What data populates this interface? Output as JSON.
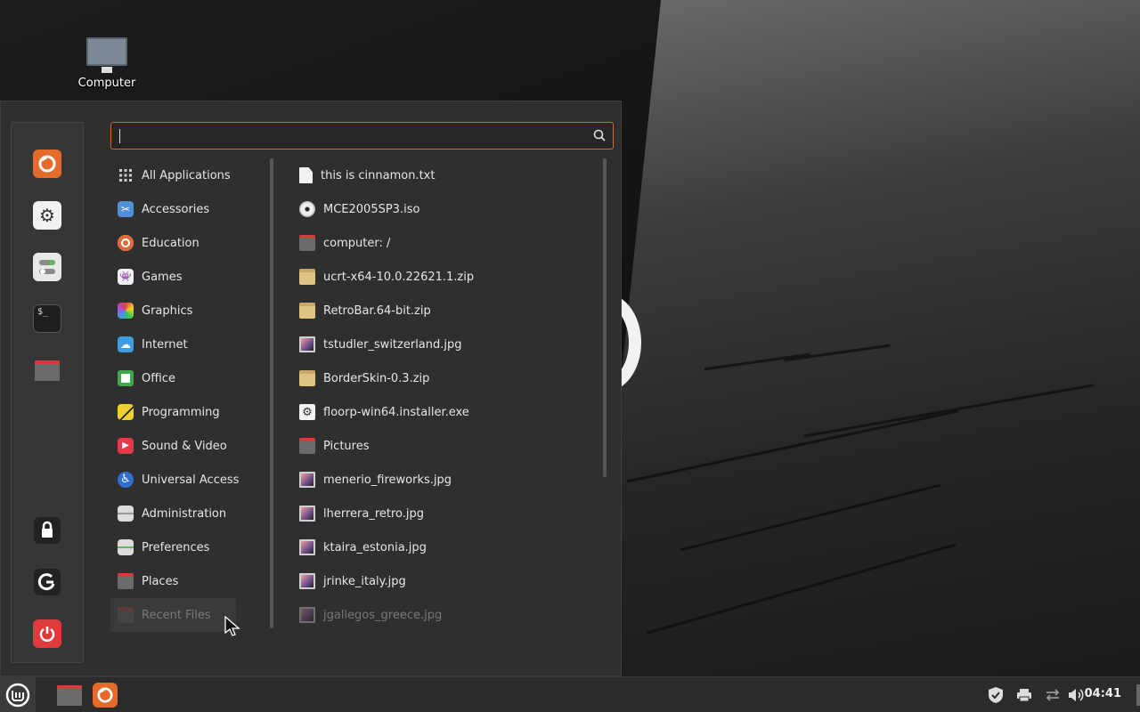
{
  "desktop": {
    "icons": [
      {
        "label": "Computer",
        "icon": "computer-icon"
      }
    ]
  },
  "menu": {
    "search": {
      "value": "",
      "placeholder": ""
    },
    "sidebar": {
      "top": [
        {
          "name": "firefox",
          "icon": "firefox-icon",
          "color": "#e66a2c"
        },
        {
          "name": "system-settings",
          "icon": "gear-icon",
          "color": "#f2f2f2"
        },
        {
          "name": "configuration",
          "icon": "toggles-icon",
          "color": "#e8e8e8"
        },
        {
          "name": "terminal",
          "icon": "terminal-icon",
          "color": "#1e1e1e"
        },
        {
          "name": "files",
          "icon": "folder-icon",
          "color": "#d23c3c"
        }
      ],
      "bottom": [
        {
          "name": "lock-screen",
          "icon": "lock-icon"
        },
        {
          "name": "logout",
          "icon": "logout-icon"
        },
        {
          "name": "shutdown",
          "icon": "power-icon",
          "color": "#e03b3b"
        }
      ]
    },
    "categories": [
      {
        "label": "All Applications",
        "icon": "grid-icon"
      },
      {
        "label": "Accessories",
        "icon": "scissors-icon",
        "color": "#4e8fd8"
      },
      {
        "label": "Education",
        "icon": "education-icon",
        "color": "#e06a3a"
      },
      {
        "label": "Games",
        "icon": "gamepad-icon",
        "color": "#f0f0f0"
      },
      {
        "label": "Graphics",
        "icon": "palette-icon",
        "color": "#d04cc8"
      },
      {
        "label": "Internet",
        "icon": "cloud-icon",
        "color": "#3d9ce0"
      },
      {
        "label": "Office",
        "icon": "office-icon",
        "color": "#3ea84a"
      },
      {
        "label": "Programming",
        "icon": "programming-icon",
        "color": "#f0d030"
      },
      {
        "label": "Sound & Video",
        "icon": "play-icon",
        "color": "#e03b4b"
      },
      {
        "label": "Universal Access",
        "icon": "accessibility-icon",
        "color": "#2f6fd0"
      },
      {
        "label": "Administration",
        "icon": "admin-icon",
        "color": "#dcdcdc"
      },
      {
        "label": "Preferences",
        "icon": "preferences-icon",
        "color": "#dcdcdc"
      },
      {
        "label": "Places",
        "icon": "folder-icon",
        "color": "#d23c3c"
      },
      {
        "label": "Recent Files",
        "icon": "recent-icon",
        "color": "#d23c3c"
      }
    ],
    "files": [
      {
        "label": "this is cinnamon.txt",
        "icon": "text-file-icon"
      },
      {
        "label": "MCE2005SP3.iso",
        "icon": "disc-icon"
      },
      {
        "label": "computer: /",
        "icon": "folder-icon"
      },
      {
        "label": "ucrt-x64-10.0.22621.1.zip",
        "icon": "archive-icon"
      },
      {
        "label": "RetroBar.64-bit.zip",
        "icon": "archive-icon"
      },
      {
        "label": "tstudler_switzerland.jpg",
        "icon": "image-icon"
      },
      {
        "label": "BorderSkin-0.3.zip",
        "icon": "archive-icon"
      },
      {
        "label": "floorp-win64.installer.exe",
        "icon": "executable-icon"
      },
      {
        "label": "Pictures",
        "icon": "folder-icon"
      },
      {
        "label": "menerio_fireworks.jpg",
        "icon": "image-icon"
      },
      {
        "label": "lherrera_retro.jpg",
        "icon": "image-icon"
      },
      {
        "label": "ktaira_estonia.jpg",
        "icon": "image-icon"
      },
      {
        "label": "jrinke_italy.jpg",
        "icon": "image-icon"
      },
      {
        "label": "jgallegos_greece.jpg",
        "icon": "image-icon"
      }
    ]
  },
  "taskbar": {
    "menu_button": "mint-logo-icon",
    "launchers": [
      "folder-icon",
      "firefox-icon"
    ],
    "tray": [
      "shield-icon",
      "printer-icon",
      "network-icon",
      "volume-icon"
    ],
    "clock": "04:41"
  }
}
